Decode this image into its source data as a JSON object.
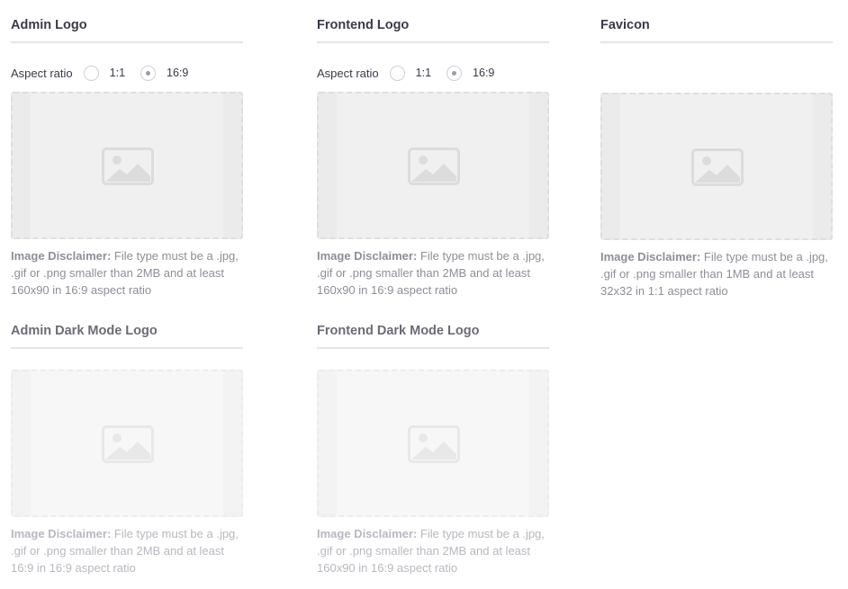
{
  "aspect_ratio_label": "Aspect ratio",
  "aspect_options": [
    "1:1",
    "16:9"
  ],
  "aspect_selected": "16:9",
  "disclaimer_label": "Image Disclaimer:",
  "cards": [
    {
      "title": "Admin Logo",
      "disclaimer": " File type must be a .jpg, .gif or .png smaller than 2MB and at least 160x90 in 16:9 aspect ratio"
    },
    {
      "title": "Frontend Logo",
      "disclaimer": " File type must be a .jpg, .gif or .png smaller than 2MB and at least 160x90 in 16:9 aspect ratio"
    },
    {
      "title": "Favicon",
      "disclaimer": " File type must be a .jpg, .gif or .png smaller than 1MB and at least 32x32 in 1:1 aspect ratio"
    },
    {
      "title": "Admin Dark Mode Logo",
      "disclaimer": " File type must be a .jpg, .gif or .png smaller than 2MB and at least 16:9 in 16:9 aspect ratio"
    },
    {
      "title": "Frontend Dark Mode Logo",
      "disclaimer": " File type must be a .jpg, .gif or .png smaller than 2MB and at least 160x90 in 16:9 aspect ratio"
    }
  ],
  "icons": {
    "upload_placeholder": "image-icon"
  }
}
